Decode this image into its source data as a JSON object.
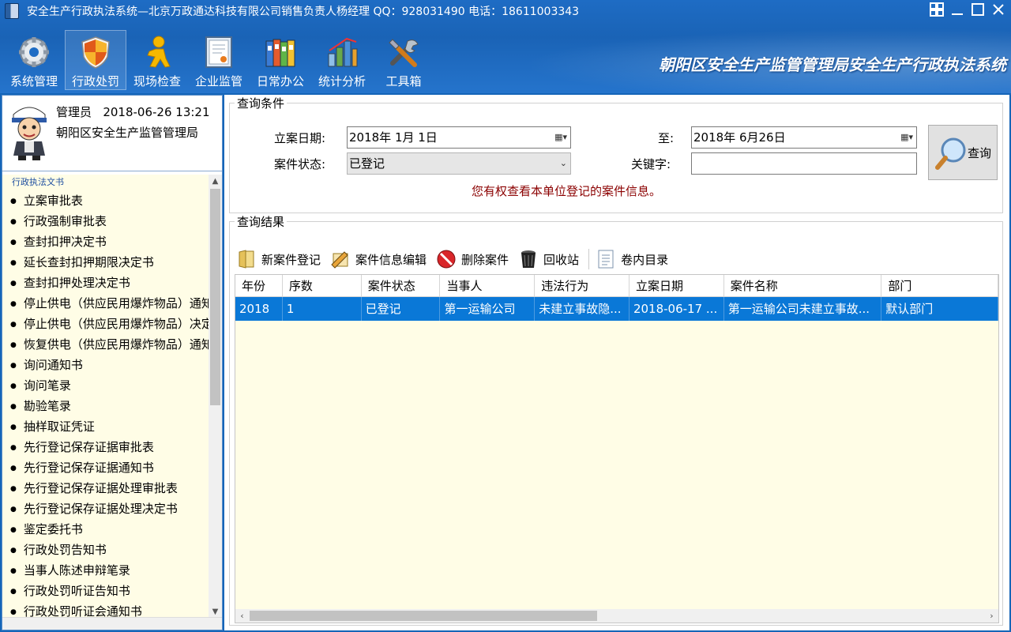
{
  "window": {
    "title": "安全生产行政执法系统—北京万政通达科技有限公司销售负责人杨经理 QQ：928031490 电话：18611003343",
    "controls": [
      "grid",
      "minimize",
      "maximize",
      "close"
    ]
  },
  "toolbar": {
    "items": [
      {
        "label": "系统管理",
        "icon": "gear-icon"
      },
      {
        "label": "行政处罚",
        "icon": "shield-icon"
      },
      {
        "label": "现场检查",
        "icon": "person-icon"
      },
      {
        "label": "企业监管",
        "icon": "certificate-icon"
      },
      {
        "label": "日常办公",
        "icon": "binders-icon"
      },
      {
        "label": "统计分析",
        "icon": "bar-chart-icon"
      },
      {
        "label": "工具箱",
        "icon": "tools-icon"
      }
    ],
    "active_index": 1
  },
  "banner": "朝阳区安全生产监管管理局安全生产行政执法系统",
  "user": {
    "role": "管理员",
    "datetime": "2018-06-26 13:21",
    "org": "朝阳区安全生产监管管理局"
  },
  "sidebar": {
    "group": "行政执法文书",
    "items": [
      "立案审批表",
      "行政强制审批表",
      "查封扣押决定书",
      "延长查封扣押期限决定书",
      "查封扣押处理决定书",
      "停止供电（供应民用爆炸物品）通知书",
      "停止供电（供应民用爆炸物品）决定书",
      "恢复供电（供应民用爆炸物品）通知书",
      "询问通知书",
      "询问笔录",
      "勘验笔录",
      "抽样取证凭证",
      "先行登记保存证据审批表",
      "先行登记保存证据通知书",
      "先行登记保存证据处理审批表",
      "先行登记保存证据处理决定书",
      "鉴定委托书",
      "行政处罚告知书",
      "当事人陈述申辩笔录",
      "行政处罚听证告知书",
      "行政处罚听证会通知书"
    ]
  },
  "query": {
    "legend": "查询条件",
    "date_label": "立案日期:",
    "date_from": "2018年  1月  1日",
    "to_label": "至:",
    "date_to": "2018年  6月26日",
    "status_label": "案件状态:",
    "status_value": "已登记",
    "keyword_label": "关键字:",
    "keyword_value": "",
    "notice": "您有权查看本单位登记的案件信息。",
    "button": "查询"
  },
  "results": {
    "legend": "查询结果",
    "actions": [
      {
        "label": "新案件登记",
        "icon": "folder-icon"
      },
      {
        "label": "案件信息编辑",
        "icon": "edit-icon"
      },
      {
        "label": "删除案件",
        "icon": "delete-icon"
      },
      {
        "label": "回收站",
        "icon": "recycle-bin-icon"
      },
      {
        "label": "卷内目录",
        "icon": "document-list-icon"
      }
    ],
    "columns": [
      "年份",
      "序数",
      "案件状态",
      "当事人",
      "违法行为",
      "立案日期",
      "案件名称",
      "部门"
    ],
    "rows": [
      [
        "2018",
        "1",
        "已登记",
        "第一运输公司",
        "未建立事故隐...",
        "2018-06-17 ...",
        "第一运输公司未建立事故...",
        "默认部门"
      ]
    ]
  }
}
